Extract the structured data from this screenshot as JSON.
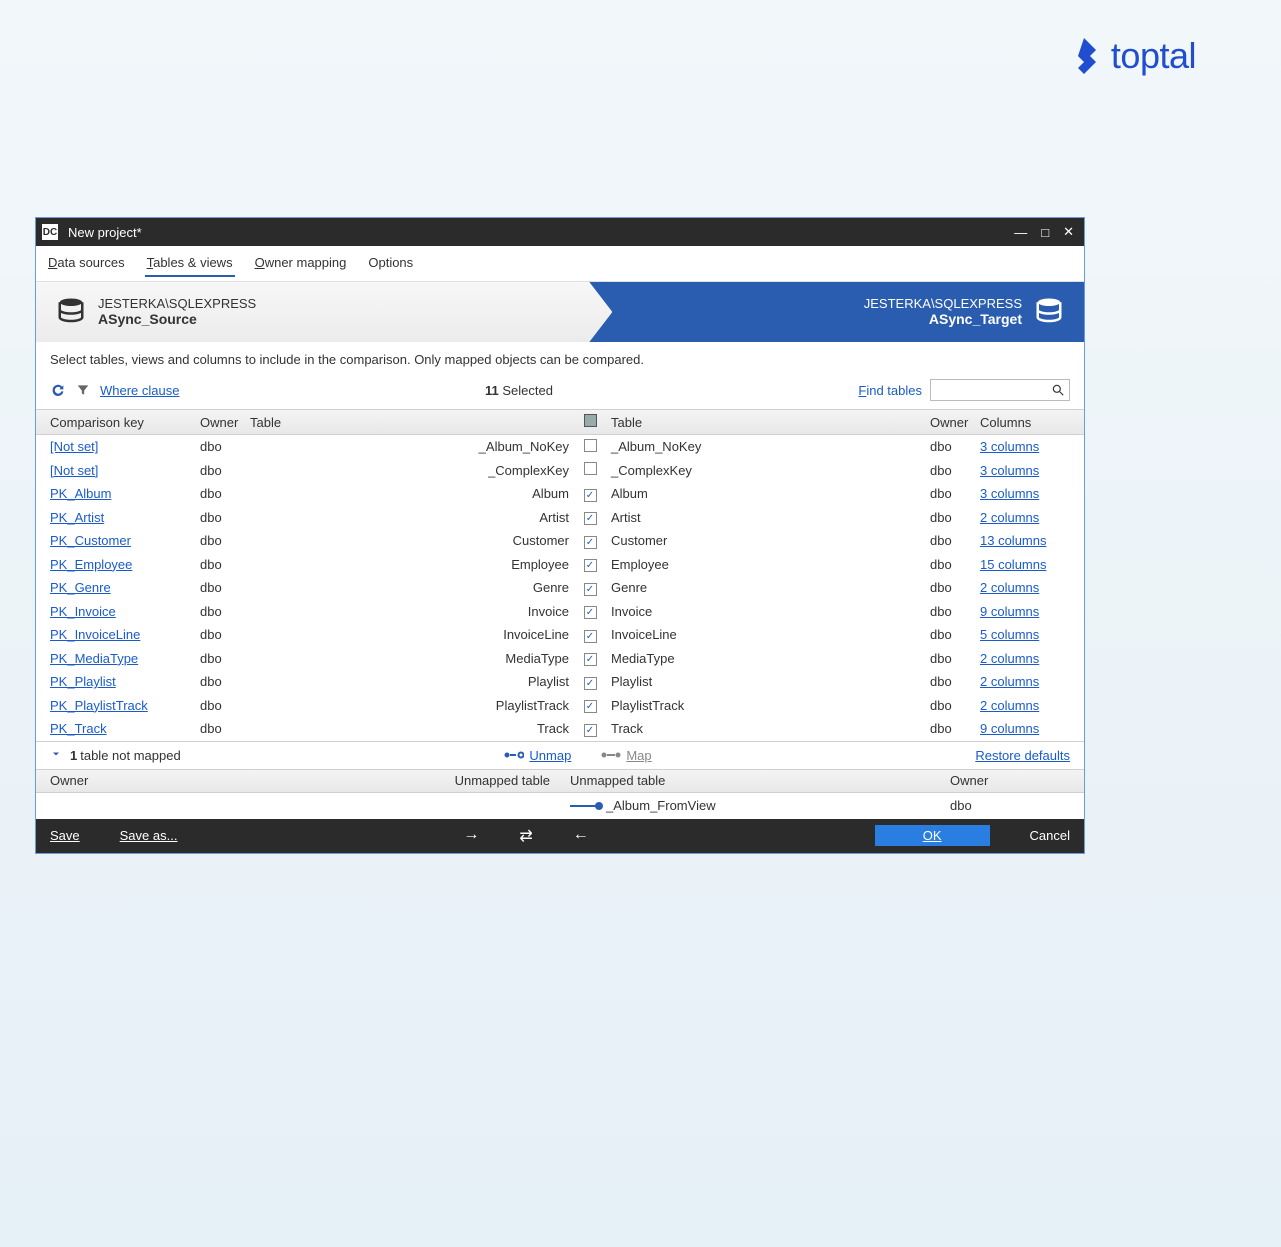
{
  "brand": "toptal",
  "window_title": "New project*",
  "menubar": [
    {
      "key": "data_sources",
      "label": "Data sources",
      "u_pos": 0,
      "active": false
    },
    {
      "key": "tables_views",
      "label": "Tables & views",
      "u_pos": 0,
      "active": true
    },
    {
      "key": "owner_mapping",
      "label": "Owner mapping",
      "u_pos": 0,
      "active": false
    },
    {
      "key": "options",
      "label": "Options",
      "u_pos": null,
      "active": false
    }
  ],
  "db_source": {
    "server": "JESTERKA\\SQLEXPRESS",
    "db": "ASync_Source"
  },
  "db_target": {
    "server": "JESTERKA\\SQLEXPRESS",
    "db": "ASync_Target"
  },
  "instruction": "Select tables, views and columns to include in the comparison. Only mapped objects can be compared.",
  "toolbar": {
    "where_label": "Where clause",
    "selected_count": "11",
    "selected_label": "Selected",
    "find_label": "Find tables"
  },
  "headers": {
    "comp_key": "Comparison key",
    "owner": "Owner",
    "table": "Table",
    "table2": "Table",
    "owner2": "Owner",
    "columns": "Columns"
  },
  "rows": [
    {
      "key": "[Not set]",
      "owner": "dbo",
      "t1": "_Album_NoKey",
      "chk": false,
      "t2": "_Album_NoKey",
      "owner2": "dbo",
      "cols": "3 columns"
    },
    {
      "key": "[Not set]",
      "owner": "dbo",
      "t1": "_ComplexKey",
      "chk": false,
      "t2": "_ComplexKey",
      "owner2": "dbo",
      "cols": "3 columns"
    },
    {
      "key": "PK_Album",
      "owner": "dbo",
      "t1": "Album",
      "chk": true,
      "t2": "Album",
      "owner2": "dbo",
      "cols": "3 columns"
    },
    {
      "key": "PK_Artist",
      "owner": "dbo",
      "t1": "Artist",
      "chk": true,
      "t2": "Artist",
      "owner2": "dbo",
      "cols": "2 columns"
    },
    {
      "key": "PK_Customer",
      "owner": "dbo",
      "t1": "Customer",
      "chk": true,
      "t2": "Customer",
      "owner2": "dbo",
      "cols": "13 columns"
    },
    {
      "key": "PK_Employee",
      "owner": "dbo",
      "t1": "Employee",
      "chk": true,
      "t2": "Employee",
      "owner2": "dbo",
      "cols": "15 columns"
    },
    {
      "key": "PK_Genre",
      "owner": "dbo",
      "t1": "Genre",
      "chk": true,
      "t2": "Genre",
      "owner2": "dbo",
      "cols": "2 columns"
    },
    {
      "key": "PK_Invoice",
      "owner": "dbo",
      "t1": "Invoice",
      "chk": true,
      "t2": "Invoice",
      "owner2": "dbo",
      "cols": "9 columns"
    },
    {
      "key": "PK_InvoiceLine",
      "owner": "dbo",
      "t1": "InvoiceLine",
      "chk": true,
      "t2": "InvoiceLine",
      "owner2": "dbo",
      "cols": "5 columns"
    },
    {
      "key": "PK_MediaType",
      "owner": "dbo",
      "t1": "MediaType",
      "chk": true,
      "t2": "MediaType",
      "owner2": "dbo",
      "cols": "2 columns"
    },
    {
      "key": "PK_Playlist",
      "owner": "dbo",
      "t1": "Playlist",
      "chk": true,
      "t2": "Playlist",
      "owner2": "dbo",
      "cols": "2 columns"
    },
    {
      "key": "PK_PlaylistTrack",
      "owner": "dbo",
      "t1": "PlaylistTrack",
      "chk": true,
      "t2": "PlaylistTrack",
      "owner2": "dbo",
      "cols": "2 columns"
    },
    {
      "key": "PK_Track",
      "owner": "dbo",
      "t1": "Track",
      "chk": true,
      "t2": "Track",
      "owner2": "dbo",
      "cols": "9 columns"
    }
  ],
  "unmapped": {
    "count": "1",
    "label": "table not mapped",
    "unmap_label": "Unmap",
    "map_label": "Map",
    "restore_label": "Restore defaults",
    "hdr_owner": "Owner",
    "hdr_ut": "Unmapped table",
    "row": {
      "t2": "_Album_FromView",
      "owner2": "dbo"
    }
  },
  "footer": {
    "save": "Save",
    "save_as": "Save as...",
    "ok": "OK",
    "cancel": "Cancel"
  }
}
